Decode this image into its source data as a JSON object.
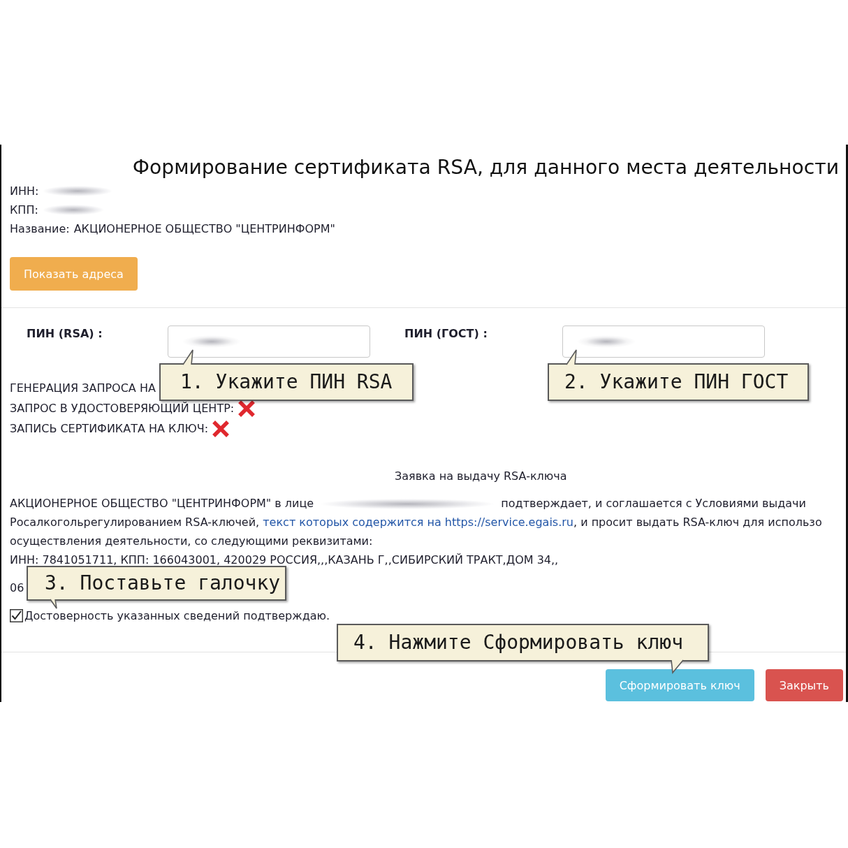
{
  "title": "Формирование сертификата RSA, для данного места деятельности",
  "info": [
    {
      "label": "ИНН:",
      "blurred": true
    },
    {
      "label": "КПП:",
      "blurred": true
    },
    {
      "label": "Название:",
      "value": "АКЦИОНЕРНОЕ ОБЩЕСТВО \"ЦЕНТРИНФОРМ\""
    }
  ],
  "show_addresses_button": {
    "label": "Показать адреса",
    "kind": "warning"
  },
  "pins": [
    {
      "label": "ПИН (RSA) :",
      "blurred": true
    },
    {
      "label": "ПИН (ГОСТ) :",
      "blurred": true
    }
  ],
  "steps": [
    {
      "label": "ГЕНЕРАЦИЯ ЗАПРОСА НА"
    },
    {
      "label": "ЗАПРОС В УДОСТОВЕРЯЮЩИЙ ЦЕНТР:",
      "done": false
    },
    {
      "label": "ЗАПИСЬ СЕРТИФИКАТА НА КЛЮЧ:",
      "done": false
    }
  ],
  "request": {
    "heading": "Заявка на выдачу RSA-ключа",
    "lines": [
      [
        {
          "kind": "text",
          "text": "АКЦИОНЕРНОЕ ОБЩЕСТВО \"ЦЕНТРИНФОРМ\" в лице "
        },
        {
          "kind": "blurred"
        },
        {
          "kind": "text",
          "text": " подтверждает, и соглашается с Условиями выдачи"
        }
      ],
      [
        {
          "kind": "text",
          "text": "Росалкогольрегулированием RSA-ключей, "
        },
        {
          "kind": "link",
          "text": "текст которых содержится на https://service.egais.ru"
        },
        {
          "kind": "text",
          "text": ", и просит выдать RSA-ключ для использо"
        }
      ],
      [
        {
          "kind": "text",
          "text": "осуществления деятельности, со следующими реквизитами:"
        }
      ]
    ],
    "requisites": "ИНН: 7841051711, КПП: 166043001, 420029 РОССИЯ,,,КАЗАНЬ Г,,СИБИРСКИЙ ТРАКТ,ДОМ 34,,",
    "partial_line": "06"
  },
  "confirm": {
    "label": "Достоверность указанных сведений подтверждаю.",
    "checked": true
  },
  "buttons": [
    {
      "label": "Сформировать ключ",
      "kind": "info"
    },
    {
      "label": "Закрыть",
      "kind": "danger"
    }
  ],
  "callouts": [
    {
      "text": "1. Укажите ПИН RSA"
    },
    {
      "text": "2. Укажите ПИН ГОСТ"
    },
    {
      "text": "3. Поставьте галочку"
    },
    {
      "text": "4. Нажмите Сформировать ключ"
    }
  ]
}
